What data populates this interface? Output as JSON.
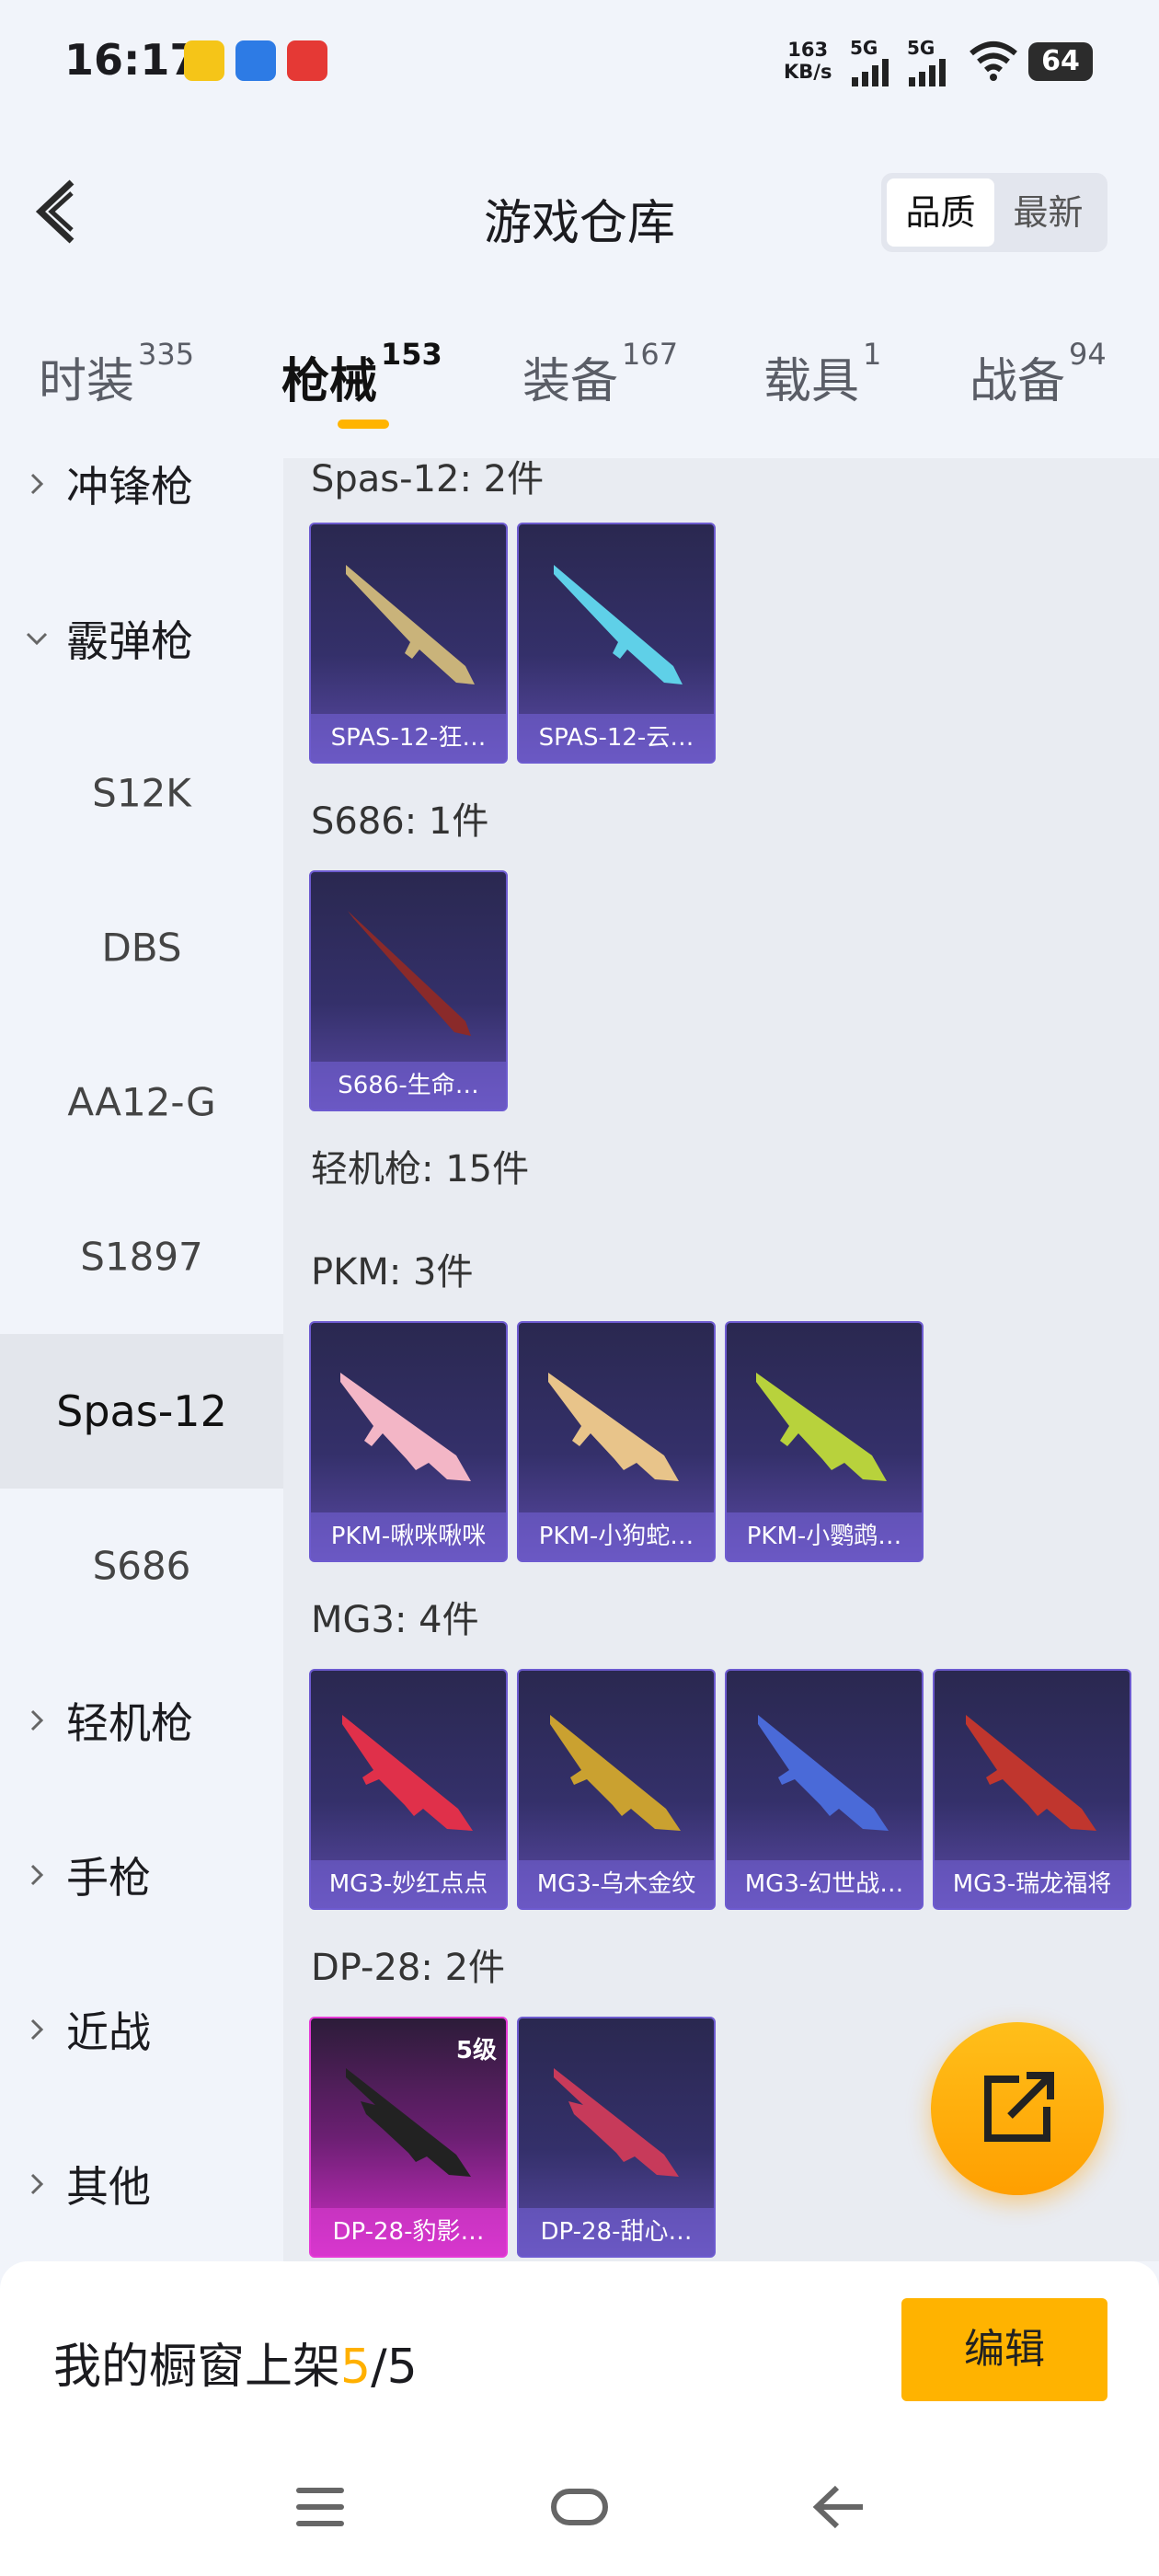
{
  "status_bar": {
    "time": "16:17",
    "net_speed_value": "163",
    "net_speed_unit": "KB/s",
    "sim1": "5G",
    "sim2": "5G",
    "battery": "64"
  },
  "header": {
    "title": "游戏仓库",
    "sort_options": [
      "品质",
      "最新"
    ],
    "sort_selected": "品质"
  },
  "tabs": [
    {
      "label": "时装",
      "count": "335"
    },
    {
      "label": "枪械",
      "count": "153"
    },
    {
      "label": "装备",
      "count": "167"
    },
    {
      "label": "载具",
      "count": "1"
    },
    {
      "label": "战备",
      "count": "94"
    }
  ],
  "active_tab": "枪械",
  "sidebar": {
    "items": [
      {
        "label": "冲锋枪",
        "type": "category",
        "expanded": false
      },
      {
        "label": "霰弹枪",
        "type": "category",
        "expanded": true
      },
      {
        "label": "S12K",
        "type": "sub"
      },
      {
        "label": "DBS",
        "type": "sub"
      },
      {
        "label": "AA12-G",
        "type": "sub"
      },
      {
        "label": "S1897",
        "type": "sub"
      },
      {
        "label": "Spas-12",
        "type": "sub",
        "selected": true
      },
      {
        "label": "S686",
        "type": "sub"
      },
      {
        "label": "轻机枪",
        "type": "category",
        "expanded": false
      },
      {
        "label": "手枪",
        "type": "category",
        "expanded": false
      },
      {
        "label": "近战",
        "type": "category",
        "expanded": false
      },
      {
        "label": "其他",
        "type": "category",
        "expanded": false
      }
    ]
  },
  "content": {
    "groups": [
      {
        "title": "Spas-12: 2件",
        "items": [
          {
            "name": "SPAS-12-狂…",
            "color": "#c9b37a"
          },
          {
            "name": "SPAS-12-云…",
            "color": "#5fd0e8"
          }
        ]
      },
      {
        "title": "S686: 1件",
        "items": [
          {
            "name": "S686-生命…",
            "color": "#8a2a2a"
          }
        ]
      },
      {
        "title": "轻机枪: 15件",
        "items": []
      },
      {
        "title": "PKM: 3件",
        "items": [
          {
            "name": "PKM-啾咪啾咪",
            "color": "#f3b6c6"
          },
          {
            "name": "PKM-小狗蛇…",
            "color": "#e8c48a"
          },
          {
            "name": "PKM-小鹦鹉…",
            "color": "#b8d23c"
          }
        ]
      },
      {
        "title": "MG3: 4件",
        "items": [
          {
            "name": "MG3-妙红点点",
            "color": "#e0304a"
          },
          {
            "name": "MG3-乌木金纹",
            "color": "#caa130"
          },
          {
            "name": "MG3-幻世战…",
            "color": "#4a6ad8"
          },
          {
            "name": "MG3-瑞龙福将",
            "color": "#c0362e"
          }
        ]
      },
      {
        "title": "DP-28: 2件",
        "items": [
          {
            "name": "DP-28-豹影…",
            "color": "#222222",
            "level": "5级",
            "rarity": "pink"
          },
          {
            "name": "DP-28-甜心…",
            "color": "#c73a5a"
          }
        ]
      }
    ]
  },
  "bottom": {
    "shelf_prefix": "我的橱窗上架",
    "shelf_current": "5",
    "shelf_total": "/5",
    "edit_label": "编辑"
  },
  "colors": {
    "accent": "#ffb400",
    "card_border": "#6d5bd0",
    "card_pink": "#e53ad6"
  },
  "icons": [
    "back-arrow-icon",
    "external-share-icon",
    "menu-nav-icon",
    "home-nav-icon",
    "back-nav-icon",
    "wifi-icon",
    "signal-icon"
  ]
}
